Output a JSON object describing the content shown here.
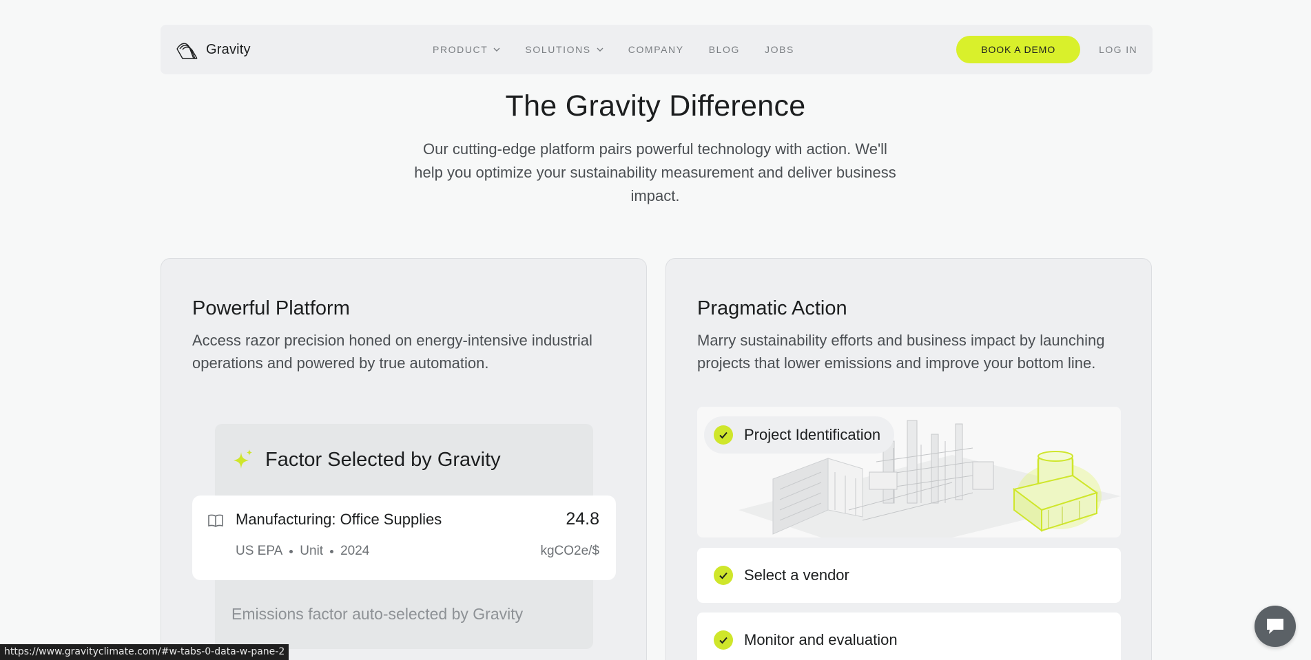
{
  "nav": {
    "brand": "Gravity",
    "links": [
      {
        "label": "PRODUCT",
        "dropdown": true
      },
      {
        "label": "SOLUTIONS",
        "dropdown": true
      },
      {
        "label": "COMPANY",
        "dropdown": false
      },
      {
        "label": "BLOG",
        "dropdown": false
      },
      {
        "label": "JOBS",
        "dropdown": false
      }
    ],
    "demo_button": "BOOK A DEMO",
    "login": "LOG IN"
  },
  "hero": {
    "title": "The Gravity Difference",
    "subtitle": "Our cutting-edge platform pairs powerful technology with action. We'll help you optimize your sustainability measurement and deliver business impact."
  },
  "platform_card": {
    "title": "Powerful Platform",
    "description": "Access razor precision honed on energy-intensive industrial operations and powered by true automation.",
    "factor_panel": {
      "title": "Factor Selected by Gravity",
      "item": {
        "name": "Manufacturing: Office Supplies",
        "value": "24.8",
        "source": "US EPA",
        "type": "Unit",
        "year": "2024",
        "unit": "kgCO2e/$"
      },
      "footer": "Emissions factor auto-selected by Gravity"
    }
  },
  "action_card": {
    "title": "Pragmatic Action",
    "description": "Marry sustainability efforts and business impact by launching projects that lower emissions and improve your bottom line.",
    "steps": [
      "Project Identification",
      "Select a vendor",
      "Monitor and evaluation"
    ]
  },
  "status_url": "https://www.gravityclimate.com/#w-tabs-0-data-w-pane-2",
  "colors": {
    "accent": "#d9f02b",
    "check": "#cfe62b",
    "card_bg": "#eeeff1"
  }
}
